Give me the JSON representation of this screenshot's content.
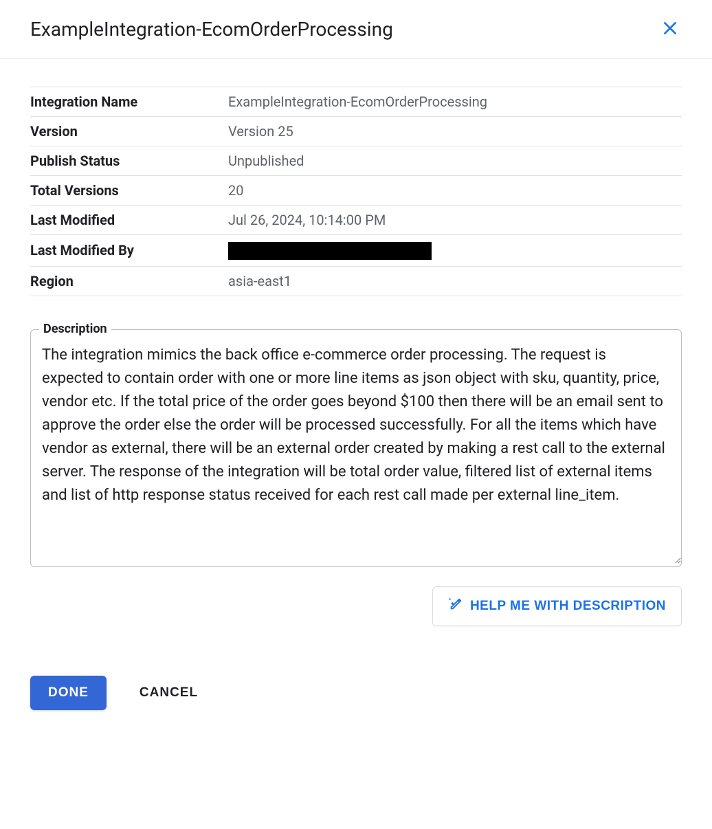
{
  "header": {
    "title": "ExampleIntegration-EcomOrderProcessing"
  },
  "details": {
    "integration_name": {
      "label": "Integration Name",
      "value": "ExampleIntegration-EcomOrderProcessing"
    },
    "version": {
      "label": "Version",
      "value": "Version 25"
    },
    "publish_status": {
      "label": "Publish Status",
      "value": "Unpublished"
    },
    "total_versions": {
      "label": "Total Versions",
      "value": "20"
    },
    "last_modified": {
      "label": "Last Modified",
      "value": "Jul 26, 2024, 10:14:00 PM"
    },
    "last_modified_by": {
      "label": "Last Modified By",
      "value": ""
    },
    "region": {
      "label": "Region",
      "value": "asia-east1"
    }
  },
  "description": {
    "label": "Description",
    "value": "The integration mimics the back office e-commerce order processing. The request is expected to contain order with one or more line items as json object with sku, quantity, price, vendor etc. If the total price of the order goes beyond $100 then there will be an email sent to approve the order else the order will be processed successfully. For all the items which have vendor as external, there will be an external order created by making a rest call to the external server. The response of the integration will be total order value, filtered list of external items and list of http response status received for each rest call made per external line_item."
  },
  "buttons": {
    "help": "HELP ME WITH DESCRIPTION",
    "done": "DONE",
    "cancel": "CANCEL"
  },
  "colors": {
    "primary": "#1a73e8",
    "primary_button": "#3367d6",
    "text": "#202124",
    "text_secondary": "#5f6368",
    "border": "#e0e0e0"
  }
}
